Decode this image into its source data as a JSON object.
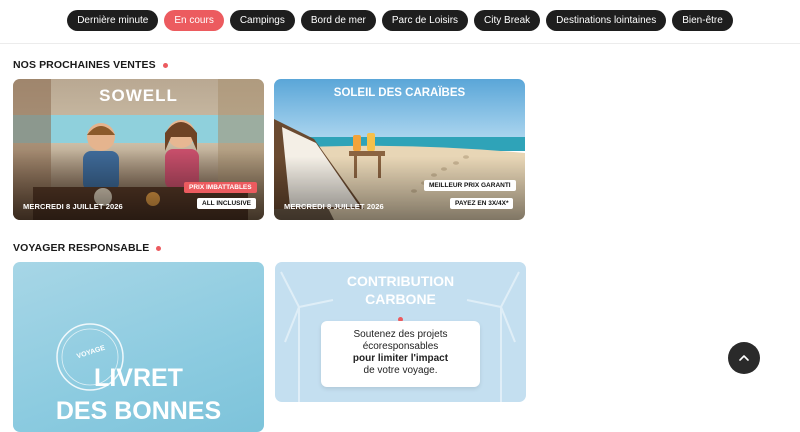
{
  "categories": [
    {
      "label": "Dernière minute",
      "active": false
    },
    {
      "label": "En cours",
      "active": true
    },
    {
      "label": "Campings",
      "active": false
    },
    {
      "label": "Bord de mer",
      "active": false
    },
    {
      "label": "Parc de Loisirs",
      "active": false
    },
    {
      "label": "City Break",
      "active": false
    },
    {
      "label": "Destinations lointaines",
      "active": false
    },
    {
      "label": "Bien-être",
      "active": false
    }
  ],
  "upcoming": {
    "title": "NOS PROCHAINES VENTES",
    "cards": [
      {
        "brand": "SOWELL",
        "date": "MERCREDI 8 JUILLET 2026",
        "badges": [
          "PRIX IMBATTABLES",
          "ALL INCLUSIVE"
        ]
      },
      {
        "brand": "SOLEIL DES CARAÏBES",
        "date": "MERCREDI 8 JUILLET 2026",
        "badges": [
          "MEILLEUR PRIX GARANTI",
          "PAYEZ EN 3X/4X*"
        ]
      }
    ]
  },
  "responsible": {
    "title": "VOYAGER RESPONSABLE",
    "booklet": {
      "stamp": "VOYAGE",
      "line1": "LIVRET",
      "line2": "DES BONNES"
    },
    "carbon": {
      "title_line1": "CONTRIBUTION",
      "title_line2": "CARBONE",
      "text_line1": "Soutenez des projets",
      "text_line2": "écoresponsables",
      "text_line3": "pour limiter l'impact",
      "text_line4": "de votre voyage."
    }
  },
  "colors": {
    "accent": "#ec5b5f",
    "chip_bg": "#1e1e1e"
  },
  "icons": {
    "scroll_top": "chevron-up-icon"
  }
}
